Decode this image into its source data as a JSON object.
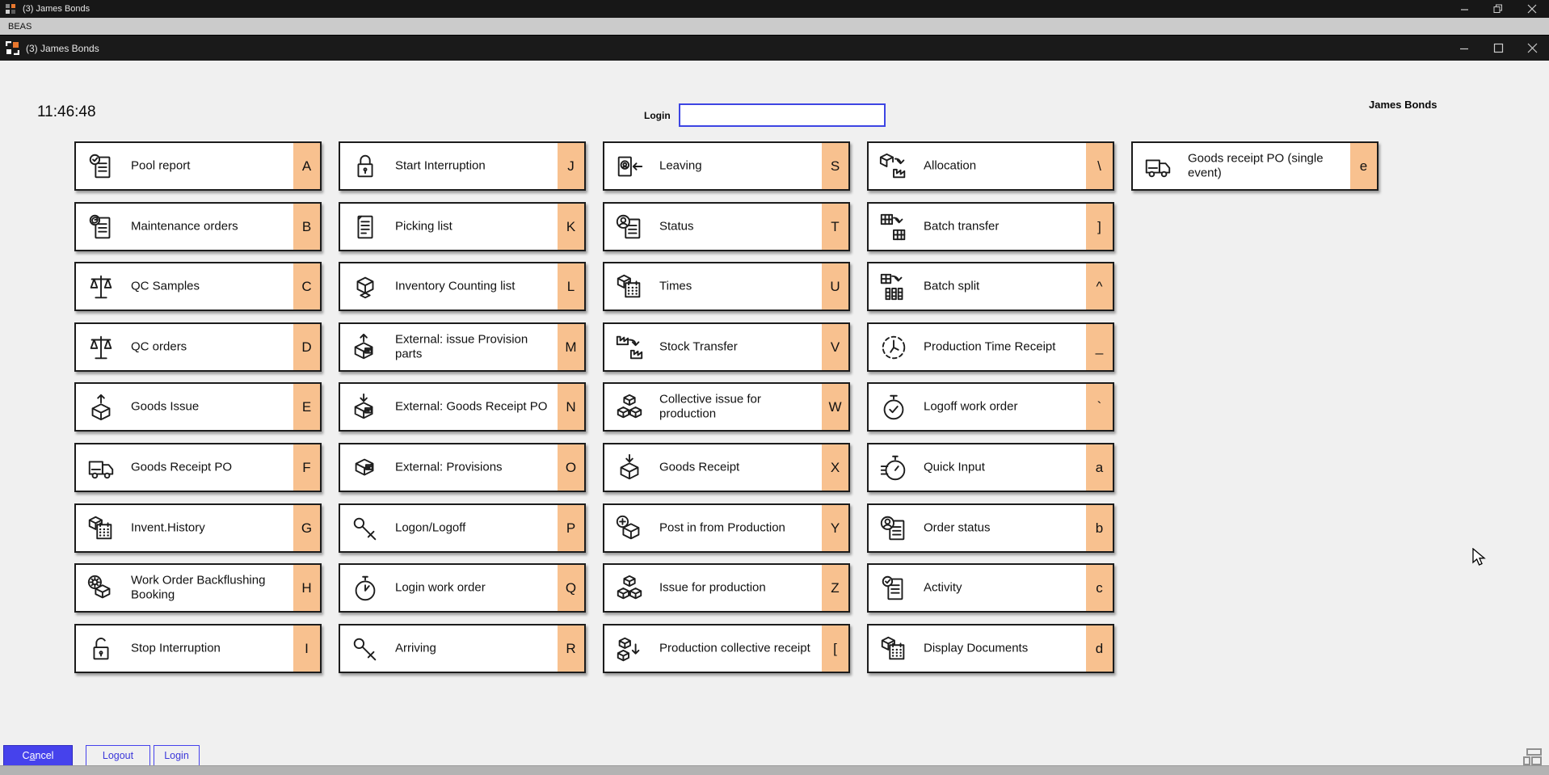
{
  "window": {
    "outer_title": "(3) James Bonds",
    "menu_bar": "BEAS",
    "inner_title": "(3) James Bonds"
  },
  "header": {
    "clock": "11:46:48",
    "login_label": "Login",
    "login_value": "",
    "user_name": "James Bonds"
  },
  "colors": {
    "key_orange": "#f8c18f",
    "accent_blue": "#4642ec",
    "tile_border": "#1c1c1c",
    "titlebar_dark": "#1a1a1a",
    "menubar_gray": "#cbcbcb"
  },
  "grid": {
    "columns": [
      {
        "buttons": [
          {
            "label": "Pool report",
            "key": "A",
            "icon": "document-check-icon"
          },
          {
            "label": "Maintenance orders",
            "key": "B",
            "icon": "document-refresh-icon"
          },
          {
            "label": "QC Samples",
            "key": "C",
            "icon": "balance-scale-icon"
          },
          {
            "label": "QC orders",
            "key": "D",
            "icon": "balance-scale-icon"
          },
          {
            "label": "Goods Issue",
            "key": "E",
            "icon": "box-arrow-up-icon"
          },
          {
            "label": "Goods Receipt PO",
            "key": "F",
            "icon": "truck-icon"
          },
          {
            "label": "Invent.History",
            "key": "G",
            "icon": "box-calendar-icon"
          },
          {
            "label": "Work Order Backflushing Booking",
            "key": "H",
            "icon": "gear-box-icon"
          },
          {
            "label": "Stop Interruption",
            "key": "I",
            "icon": "lock-open-icon"
          }
        ]
      },
      {
        "buttons": [
          {
            "label": "Start Interruption",
            "key": "J",
            "icon": "lock-closed-icon"
          },
          {
            "label": "Picking list",
            "key": "K",
            "icon": "document-lines-icon"
          },
          {
            "label": "Inventory Counting list",
            "key": "L",
            "icon": "cubes-icon"
          },
          {
            "label": "External: issue Provision parts",
            "key": "M",
            "icon": "box-label-up-icon"
          },
          {
            "label": "External: Goods Receipt PO",
            "key": "N",
            "icon": "box-label-down-icon"
          },
          {
            "label": "External: Provisions",
            "key": "O",
            "icon": "box-label-icon"
          },
          {
            "label": "Logon/Logoff",
            "key": "P",
            "icon": "key-icon"
          },
          {
            "label": "Login work order",
            "key": "Q",
            "icon": "stopwatch-icon"
          },
          {
            "label": "Arriving",
            "key": "R",
            "icon": "key-icon"
          }
        ]
      },
      {
        "buttons": [
          {
            "label": "Leaving",
            "key": "S",
            "icon": "badge-arrow-left-icon"
          },
          {
            "label": "Status",
            "key": "T",
            "icon": "person-document-icon"
          },
          {
            "label": "Times",
            "key": "U",
            "icon": "box-calendar-icon"
          },
          {
            "label": "Stock Transfer",
            "key": "V",
            "icon": "factory-transfer-icon"
          },
          {
            "label": "Collective issue for production",
            "key": "W",
            "icon": "cubes-cluster-icon"
          },
          {
            "label": "Goods Receipt",
            "key": "X",
            "icon": "box-arrow-in-icon"
          },
          {
            "label": "Post in from Production",
            "key": "Y",
            "icon": "box-plus-icon"
          },
          {
            "label": "Issue for production",
            "key": "Z",
            "icon": "cubes-cluster-icon"
          },
          {
            "label": "Production collective receipt",
            "key": "[",
            "icon": "cubes-arrow-down-icon"
          }
        ]
      },
      {
        "buttons": [
          {
            "label": "Allocation",
            "key": "\\",
            "icon": "box-to-factory-icon"
          },
          {
            "label": "Batch transfer",
            "key": "]",
            "icon": "grid-transfer-icon"
          },
          {
            "label": "Batch split",
            "key": "^",
            "icon": "grid-split-icon"
          },
          {
            "label": "Production Time Receipt",
            "key": "_",
            "icon": "clock-dashed-icon"
          },
          {
            "label": "Logoff work order",
            "key": "`",
            "icon": "stopwatch-check-icon"
          },
          {
            "label": "Quick Input",
            "key": "a",
            "icon": "stopwatch-lines-icon"
          },
          {
            "label": "Order status",
            "key": "b",
            "icon": "person-document-icon"
          },
          {
            "label": "Activity",
            "key": "c",
            "icon": "document-check-icon"
          },
          {
            "label": "Display Documents",
            "key": "d",
            "icon": "box-calendar-icon"
          }
        ]
      },
      {
        "buttons": [
          {
            "label": "Goods receipt PO  (single event)",
            "key": "e",
            "icon": "truck-icon"
          }
        ]
      }
    ]
  },
  "footer": {
    "buttons": [
      {
        "label": "Cancel",
        "accesskey": "a",
        "style": "primary"
      },
      {
        "label": "Logout",
        "style": "secondary"
      },
      {
        "label": "Login",
        "style": "secondary"
      }
    ]
  }
}
